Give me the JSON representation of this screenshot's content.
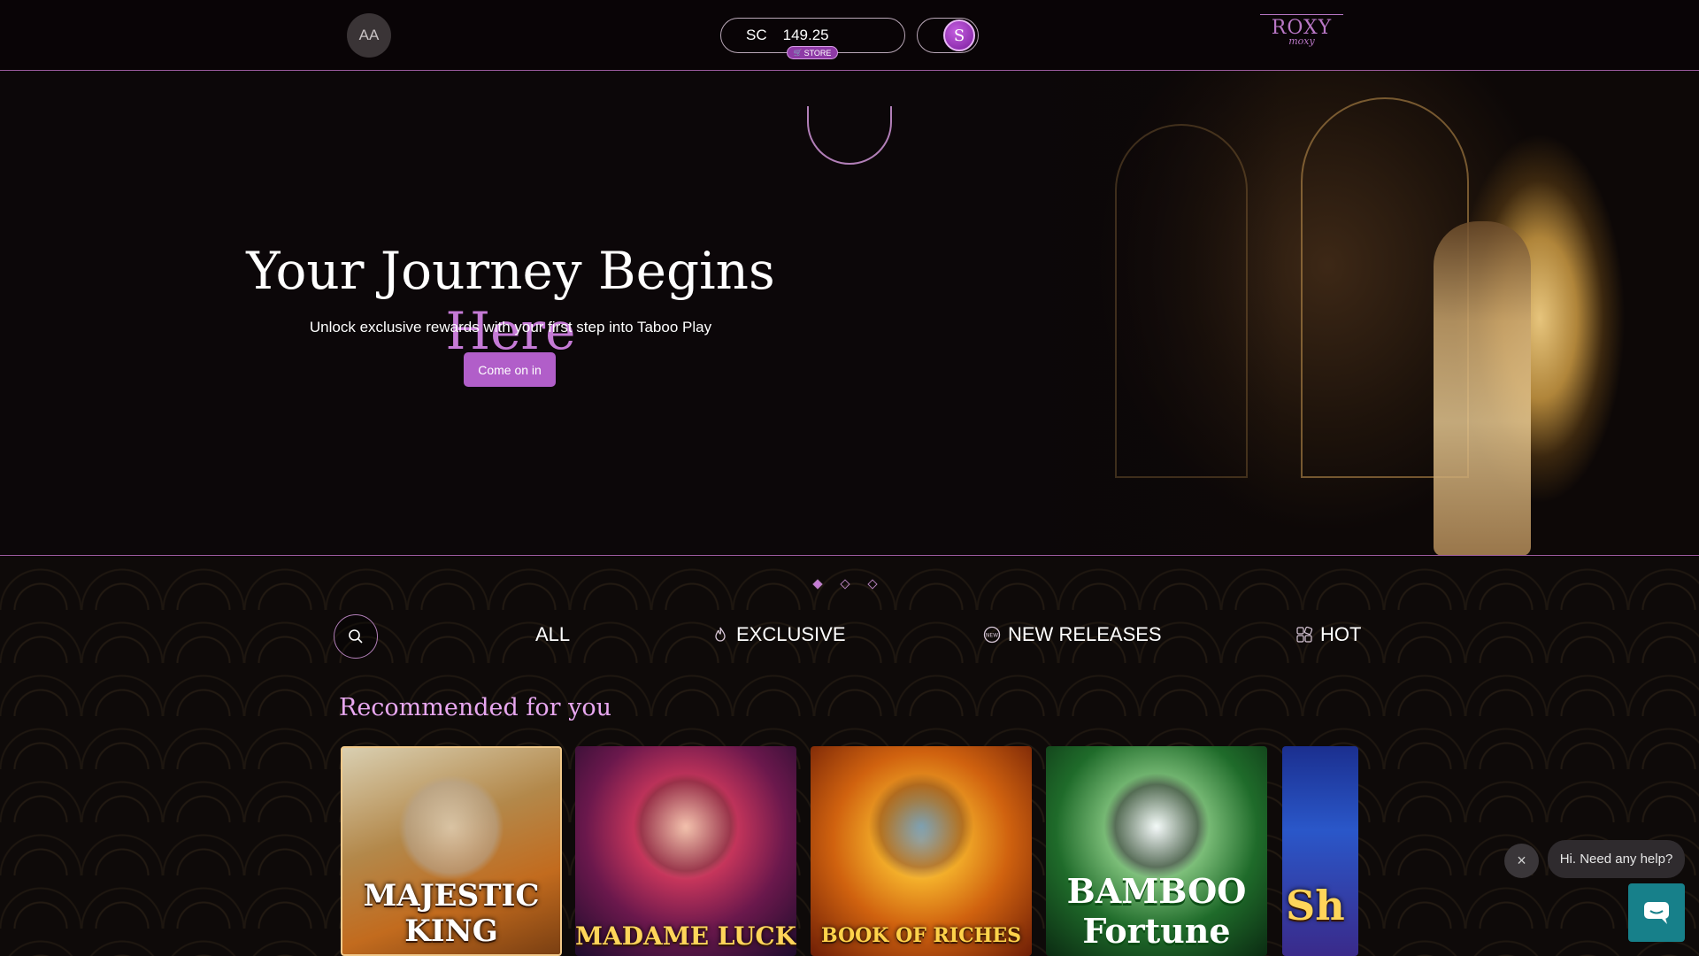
{
  "header": {
    "avatar_initials": "AA",
    "currency": "SC",
    "balance": "149.25",
    "store_label": "STORE",
    "coin_symbol": "S",
    "logo_line1": "ROXY",
    "logo_line2": "moxy"
  },
  "hero": {
    "title_main": "Your Journey Begins ",
    "title_accent": "Here",
    "subtitle": "Unlock exclusive rewards with your first step into Taboo Play",
    "cta_label": "Come on in"
  },
  "carousel": {
    "slides": 3,
    "active_index": 0
  },
  "tabs": [
    {
      "label": "ALL",
      "icon": ""
    },
    {
      "label": "EXCLUSIVE",
      "icon": "flame-icon"
    },
    {
      "label": "NEW RELEASES",
      "icon": "new-badge-icon"
    },
    {
      "label": "HOT",
      "icon": "dice-icon"
    }
  ],
  "section_title": "Recommended for you",
  "games": [
    {
      "title": "MAJESTIC KING"
    },
    {
      "title": "MADAME LUCK"
    },
    {
      "title": "BOOK OF RICHES"
    },
    {
      "title": "BAMBOO Fortune"
    },
    {
      "title": "Sh"
    }
  ],
  "chat": {
    "close_symbol": "×",
    "bubble_text": "Hi. Need any help?"
  },
  "colors": {
    "accent": "#c57ad6",
    "cta": "#b15ec9",
    "chat": "#17808a"
  }
}
